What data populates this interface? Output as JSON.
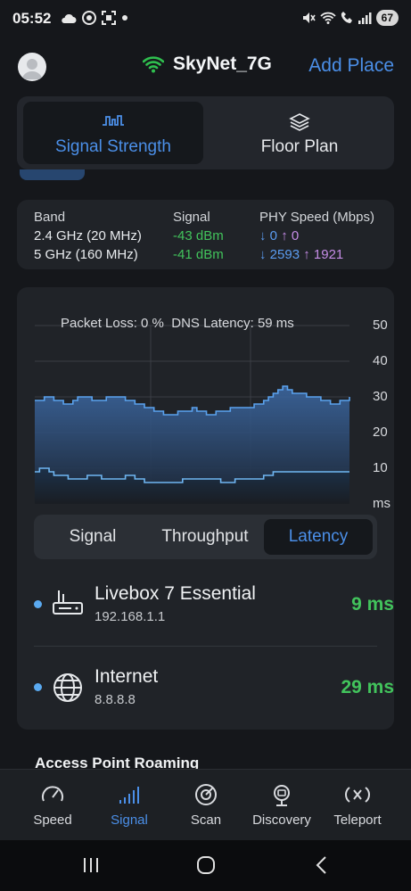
{
  "status_bar": {
    "time": "05:52",
    "left_icons": [
      "cloud-icon",
      "record-icon",
      "screenshot-icon",
      "dot-icon"
    ],
    "right_icons": [
      "mute-icon",
      "wifi-icon",
      "call-icon",
      "signal-bars-icon"
    ],
    "battery": "67"
  },
  "header": {
    "avatar_icon": "user-avatar-icon",
    "wifi_icon": "wifi-icon",
    "wifi_color": "#2fbf4f",
    "network_name": "SkyNet_7G",
    "add_place_label": "Add Place"
  },
  "top_tabs": [
    {
      "label": "Signal Strength",
      "icon": "signal-strength-icon",
      "active": true
    },
    {
      "label": "Floor Plan",
      "icon": "layers-icon",
      "active": false
    }
  ],
  "bands": {
    "headers": {
      "band": "Band",
      "signal": "Signal",
      "phy": "PHY Speed (Mbps)"
    },
    "rows": [
      {
        "band": "2.4 GHz (20 MHz)",
        "signal": "-43 dBm",
        "down": "0",
        "up": "0"
      },
      {
        "band": "5 GHz (160 MHz)",
        "signal": "-41 dBm",
        "down": "2593",
        "up": "1921"
      }
    ],
    "down_arrow": "↓",
    "up_arrow": "↑"
  },
  "chart": {
    "packet_loss_text": "Packet Loss: 0 %",
    "dns_latency_text": "DNS Latency: 59 ms",
    "y_ticks": [
      "50",
      "40",
      "30",
      "20",
      "10"
    ],
    "unit_label": "ms"
  },
  "chart_data": {
    "type": "area",
    "ylim": [
      0,
      50
    ],
    "ylabel": "ms",
    "grid": true,
    "series": [
      {
        "values": [
          29,
          29,
          30,
          30,
          29,
          29,
          28,
          28,
          29,
          30,
          30,
          30,
          29,
          29,
          29,
          30,
          30,
          30,
          30,
          29,
          29,
          28,
          28,
          27,
          27,
          26,
          26,
          25,
          25,
          25,
          26,
          26,
          26,
          27,
          26,
          26,
          25,
          25,
          26,
          26,
          26,
          27,
          27,
          27,
          27,
          27,
          28,
          28,
          29,
          30,
          31,
          32,
          33,
          32,
          31,
          31,
          31,
          30,
          30,
          30,
          29,
          29,
          28,
          28,
          29,
          29,
          30
        ]
      },
      {
        "values": [
          9,
          10,
          10,
          9,
          8,
          8,
          8,
          7,
          7,
          7,
          7,
          8,
          8,
          8,
          7,
          7,
          7,
          7,
          7,
          8,
          8,
          7,
          7,
          6,
          6,
          6,
          6,
          6,
          6,
          6,
          6,
          7,
          7,
          7,
          7,
          7,
          7,
          7,
          7,
          6,
          6,
          6,
          7,
          7,
          7,
          7,
          7,
          7,
          8,
          8,
          9,
          9,
          9,
          9,
          9,
          9,
          9,
          9,
          9,
          9,
          9,
          9,
          9,
          9,
          9,
          9,
          9
        ]
      }
    ]
  },
  "sub_tabs": [
    {
      "label": "Signal",
      "active": false
    },
    {
      "label": "Throughput",
      "active": false
    },
    {
      "label": "Latency",
      "active": true
    }
  ],
  "latency_rows": [
    {
      "icon": "router-icon",
      "name": "Livebox 7 Essential",
      "address": "192.168.1.1",
      "value": "9 ms"
    },
    {
      "icon": "globe-icon",
      "name": "Internet",
      "address": "8.8.8.8",
      "value": "29 ms"
    }
  ],
  "roaming_title": "Access Point Roaming",
  "bottom_nav": [
    {
      "label": "Speed",
      "icon": "speedometer-icon",
      "active": false
    },
    {
      "label": "Signal",
      "icon": "signal-bars-icon",
      "active": true
    },
    {
      "label": "Scan",
      "icon": "radar-icon",
      "active": false
    },
    {
      "label": "Discovery",
      "icon": "device-discovery-icon",
      "active": false
    },
    {
      "label": "Teleport",
      "icon": "teleport-icon",
      "active": false
    }
  ],
  "colors": {
    "accent": "#4b8fe8",
    "good": "#42c45c",
    "upload": "#c58ce6",
    "background": "#15171b",
    "card": "#202328"
  }
}
